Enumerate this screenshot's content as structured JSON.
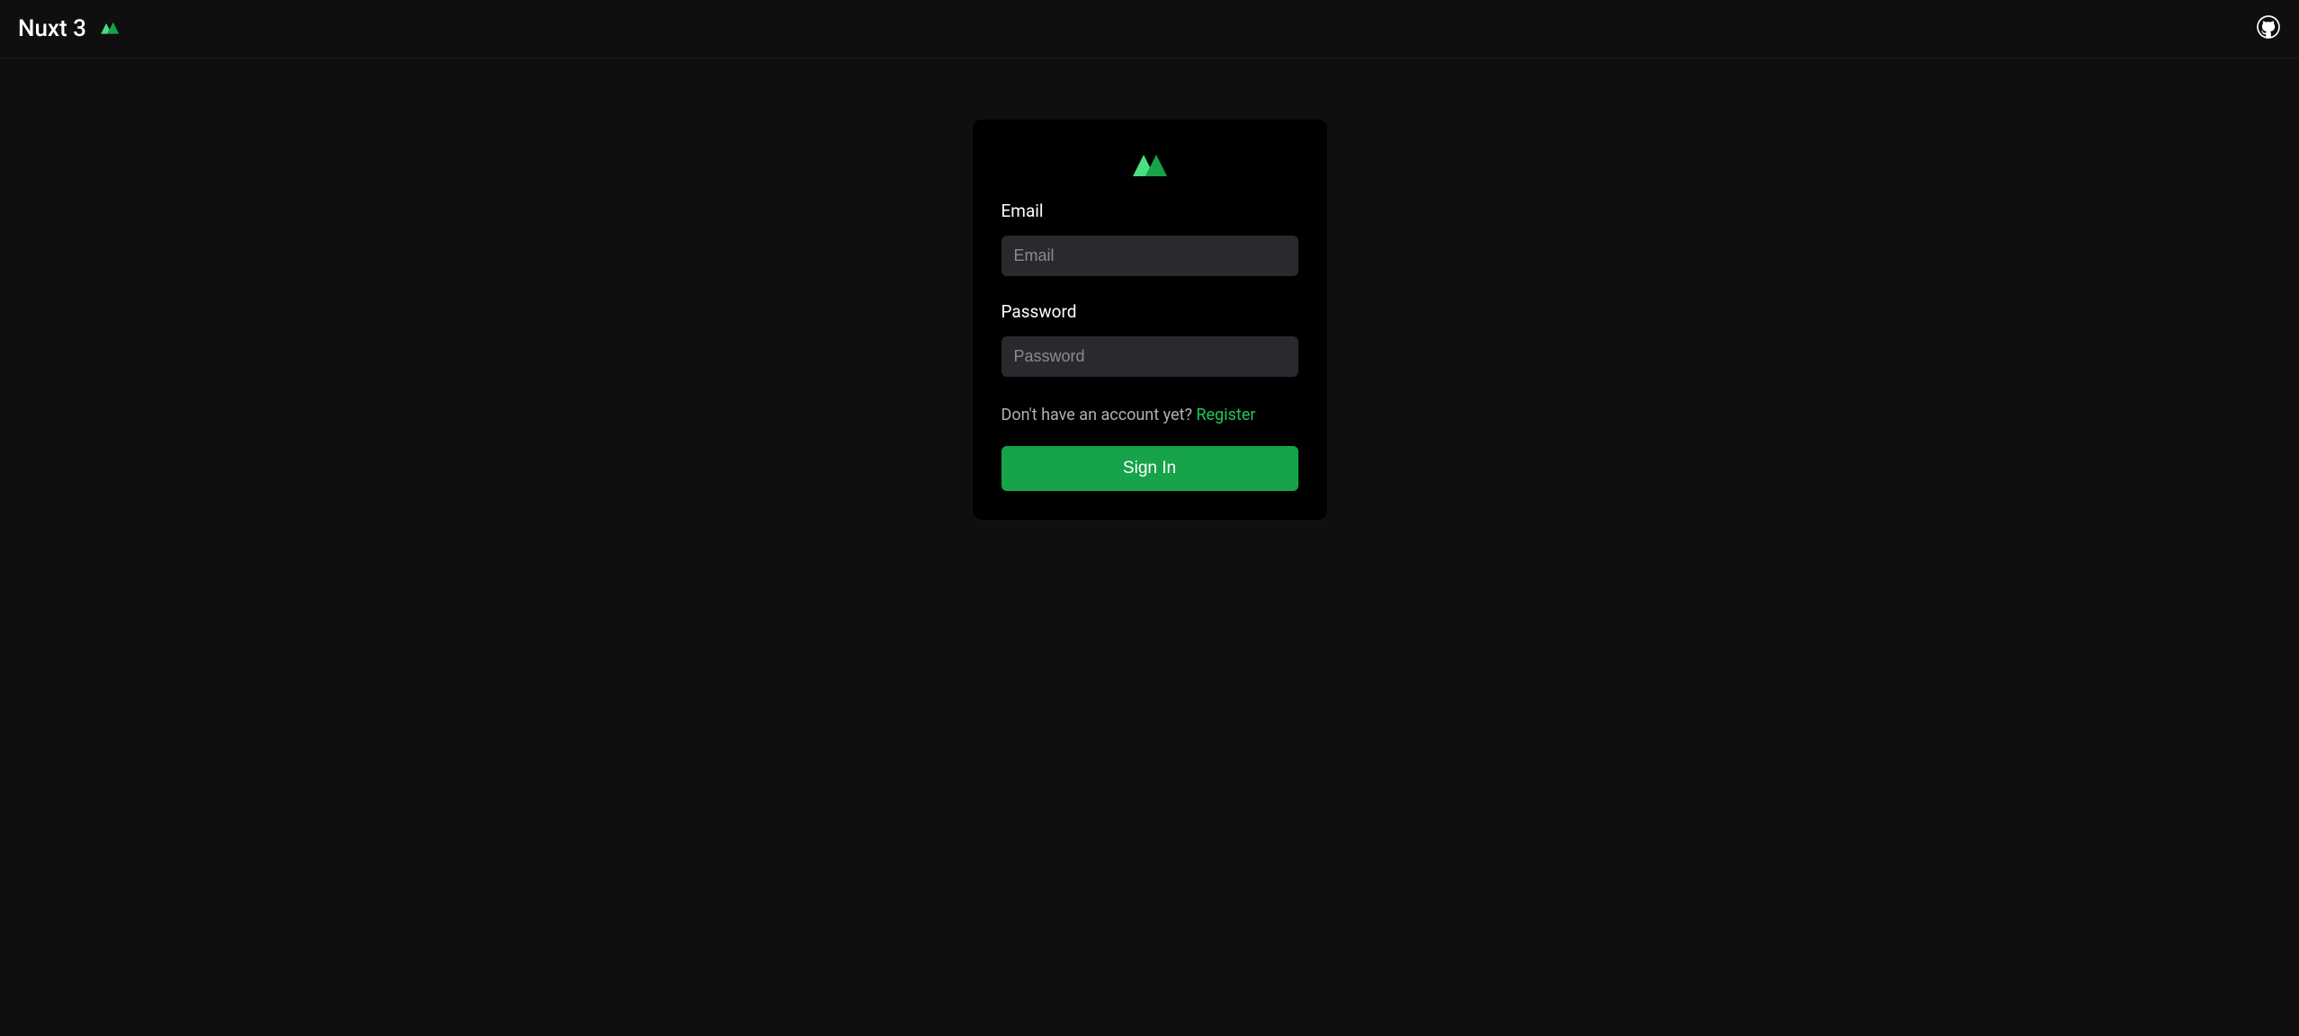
{
  "header": {
    "title": "Nuxt 3"
  },
  "form": {
    "email": {
      "label": "Email",
      "placeholder": "Email",
      "value": ""
    },
    "password": {
      "label": "Password",
      "placeholder": "Password",
      "value": ""
    },
    "register_prompt": "Don't have an account yet? ",
    "register_link": "Register",
    "signin_button": "Sign In"
  },
  "colors": {
    "accent": "#22c55e",
    "button": "#16a34a",
    "background": "#0f0f0f",
    "card": "#000000",
    "input": "#2a2a2e"
  }
}
